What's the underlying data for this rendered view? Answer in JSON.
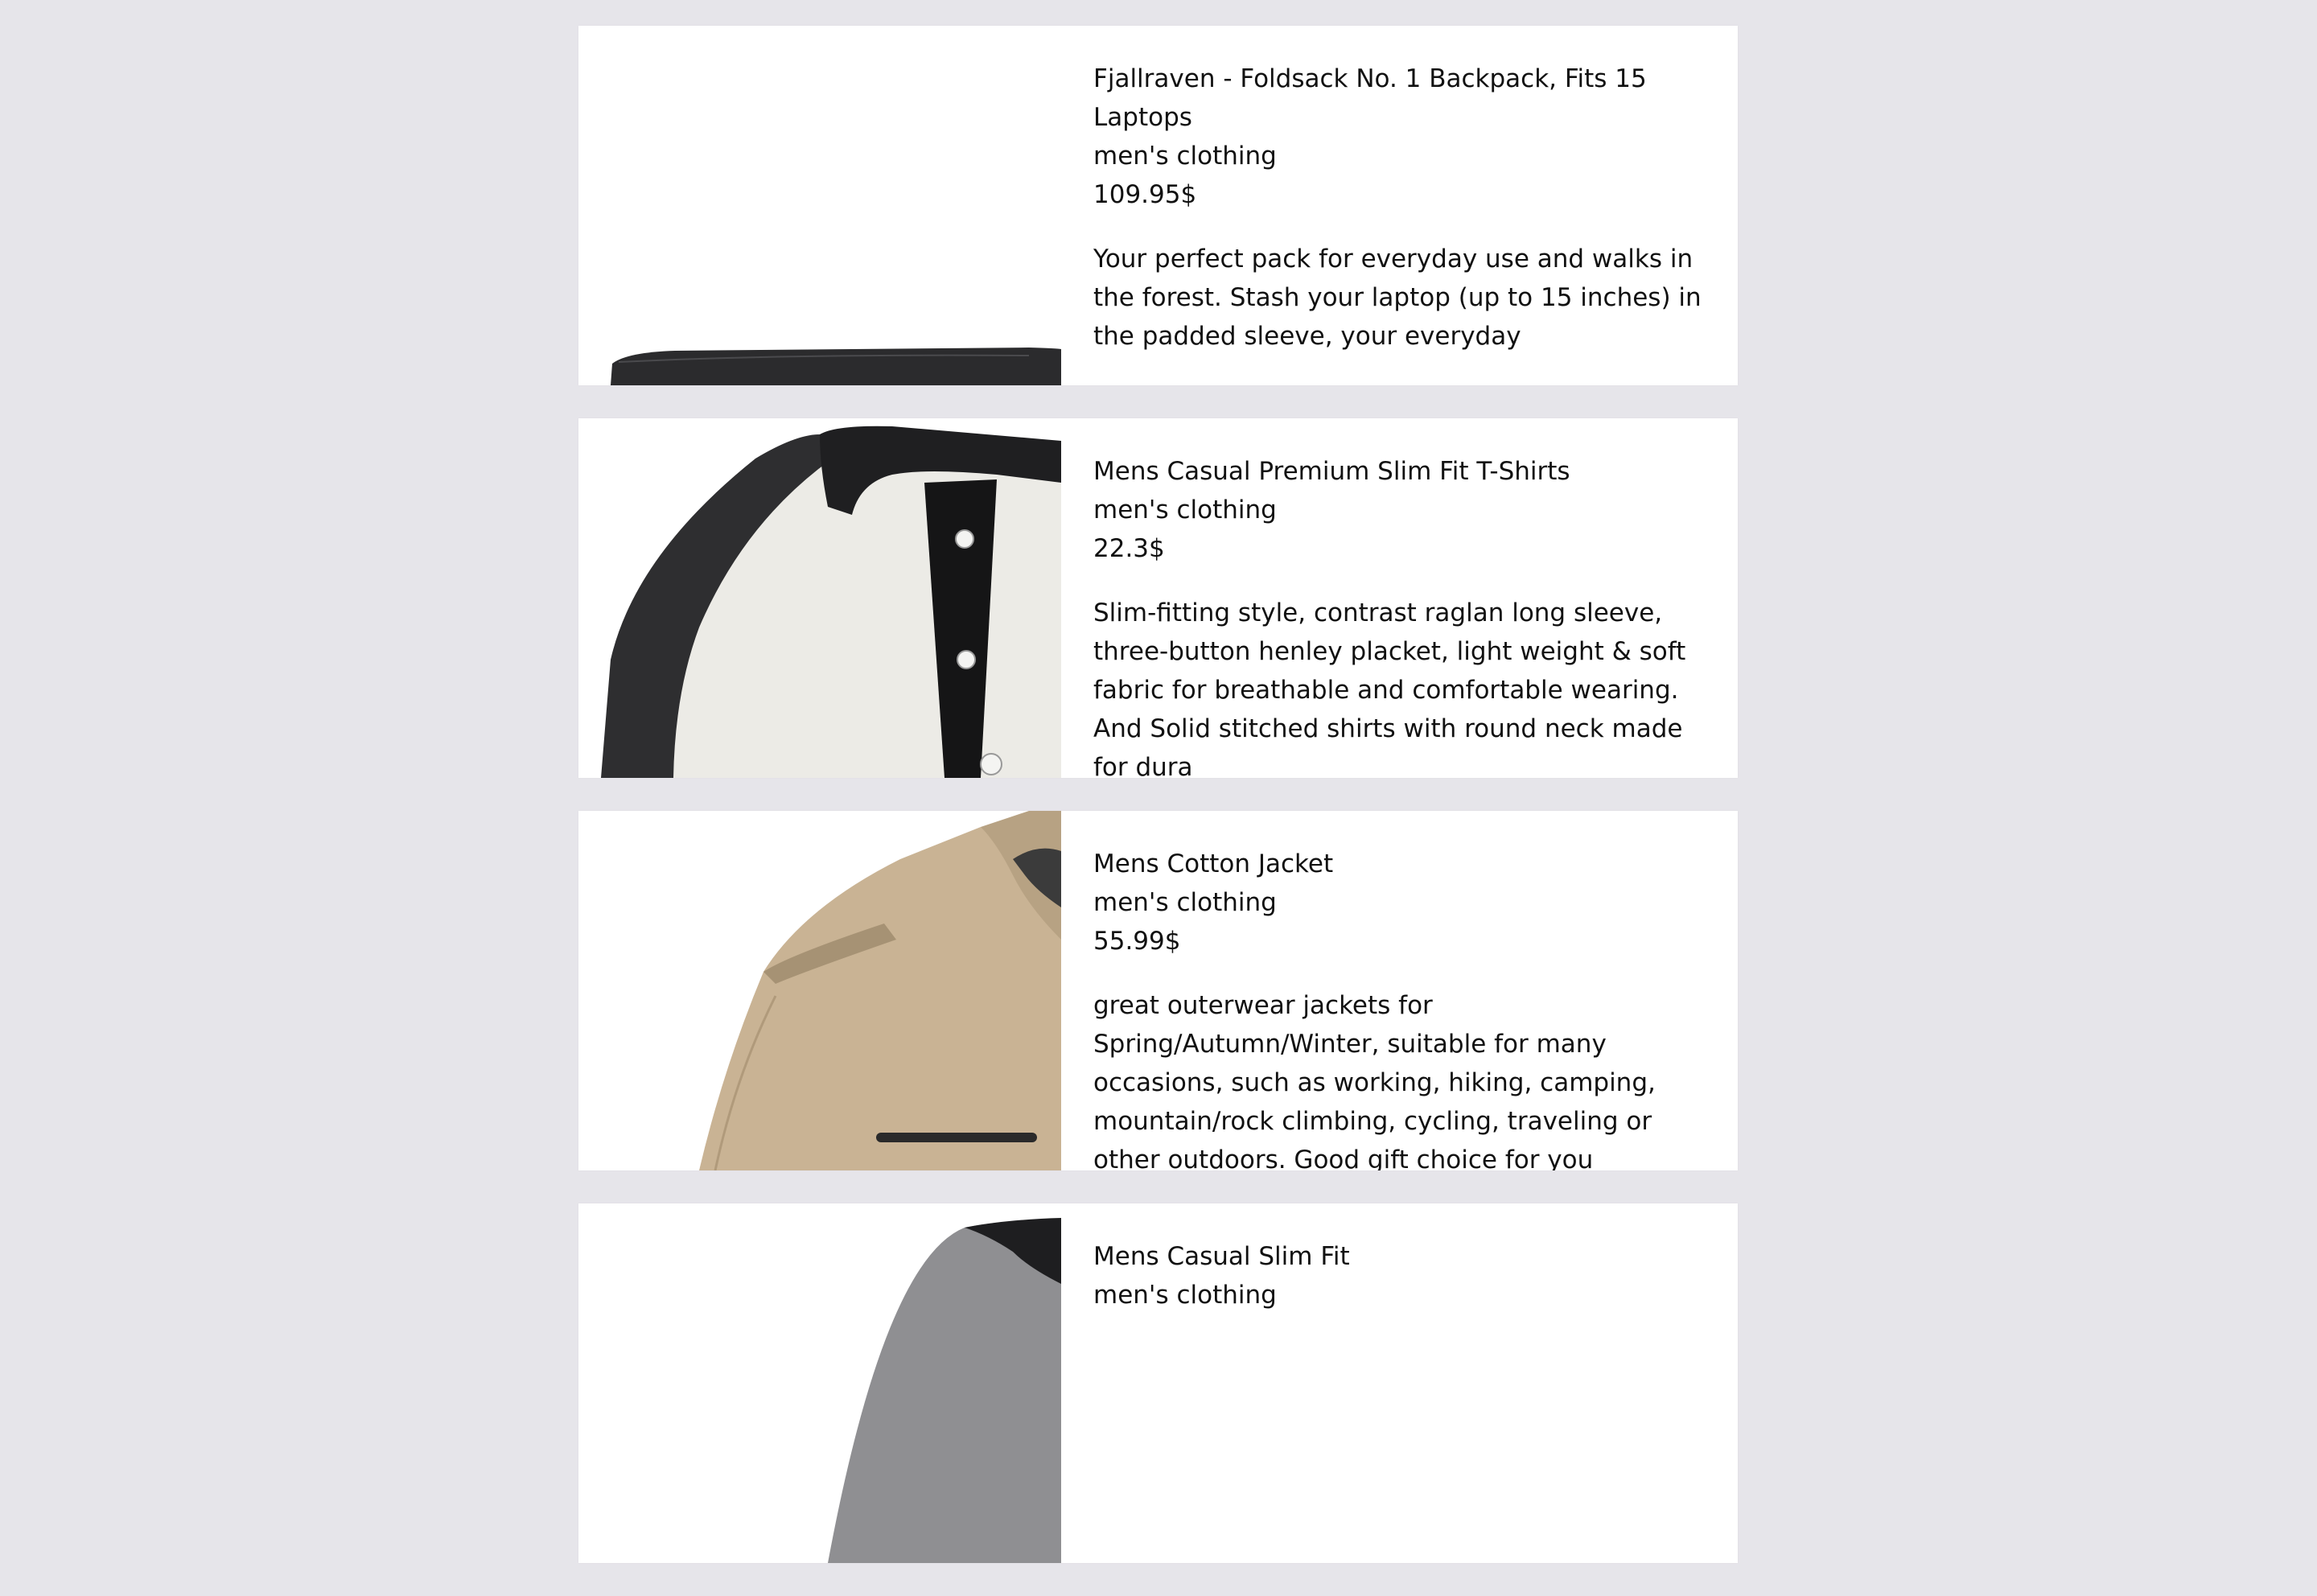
{
  "products": [
    {
      "title": "Fjallraven - Foldsack No. 1 Backpack, Fits 15 Laptops",
      "category": "men's clothing",
      "price": "109.95$",
      "description": "Your perfect pack for everyday use and walks in the forest. Stash your laptop (up to 15 inches) in the padded sleeve, your everyday",
      "image": "backpack"
    },
    {
      "title": "Mens Casual Premium Slim Fit T-Shirts",
      "category": "men's clothing",
      "price": "22.3$",
      "description": "Slim-fitting style, contrast raglan long sleeve, three-button henley placket, light weight & soft fabric for breathable and comfortable wearing. And Solid stitched shirts with round neck made for dura",
      "image": "henley-shirt"
    },
    {
      "title": "Mens Cotton Jacket",
      "category": "men's clothing",
      "price": "55.99$",
      "description": "great outerwear jackets for Spring/Autumn/Winter, suitable for many occasions, such as working, hiking, camping, mountain/rock climbing, cycling, traveling or other outdoors. Good gift choice for you",
      "image": "cotton-jacket"
    },
    {
      "title": "Mens Casual Slim Fit",
      "category": "men's clothing",
      "price": "",
      "description": "",
      "image": "slim-fit-shirt"
    }
  ]
}
